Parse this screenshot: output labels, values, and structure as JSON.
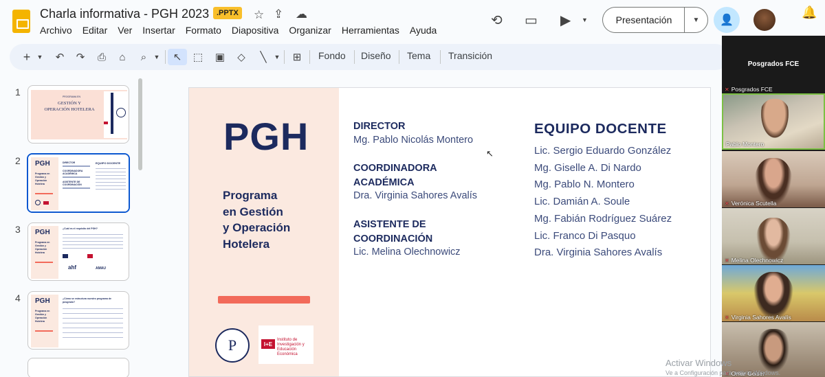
{
  "header": {
    "title": "Charla informativa - PGH 2023",
    "badge": ".PPTX",
    "menu": [
      "Archivo",
      "Editar",
      "Ver",
      "Insertar",
      "Formato",
      "Diapositiva",
      "Organizar",
      "Herramientas",
      "Ayuda"
    ],
    "present_label": "Presentación"
  },
  "toolbar": {
    "fondo": "Fondo",
    "diseno": "Diseño",
    "tema": "Tema",
    "transicion": "Transición"
  },
  "filmstrip": {
    "numbers": [
      "1",
      "2",
      "3",
      "4"
    ],
    "slide1": {
      "small": "PROGRAMA EN",
      "title1": "GESTIÓN Y",
      "title2": "OPERACIÓN HOTELERA"
    },
    "slide_pgh": "PGH",
    "slide2": {
      "left": "Programa en Gestión y Operación Hotelera",
      "col1a": "DIRECTOR",
      "col1b": "COORDINADORA ACADÉMICA",
      "col1c": "ASISTENTE DE COORDINACIÓN",
      "col2": "EQUIPO DOCENTE"
    },
    "slide3": {
      "q": "¿Cuál es el requisito del PGH?",
      "logo1": "ahf",
      "logo2": "AMAU"
    },
    "slide4": {
      "q": "¿Cómo se estructura nuestro programa de posgrado?"
    }
  },
  "slide": {
    "pgh": "PGH",
    "program": [
      "Programa",
      "en Gestión",
      "y Operación",
      "Hotelera"
    ],
    "director_role": "DIRECTOR",
    "director_name": "Mg. Pablo Nicolás Montero",
    "coord_role_1": "COORDINADORA",
    "coord_role_2": "ACADÉMICA",
    "coord_name": "Dra. Virginia Sahores Avalís",
    "asist_role_1": "ASISTENTE DE",
    "asist_role_2": "COORDINACIÓN",
    "asist_name": "Lic. Melina Olechnowicz",
    "equipo_title": "EQUIPO DOCENTE",
    "equipo": [
      "Lic. Sergio Eduardo González",
      "Mg. Giselle A. Di Nardo",
      "Mg. Pablo N. Montero",
      "Lic. Damián A. Soule",
      "Mg. Fabián Rodríguez Suárez",
      "Lic. Franco Di Pasquo",
      "Dra. Virginia Sahores Avalís"
    ],
    "seal_letter": "P",
    "iie_box": "I+E",
    "iie_text": "Instituto de Investigación y Educación Económica"
  },
  "video": {
    "host": "Posgrados FCE",
    "participants": [
      "Posgrados FCE",
      "Pablo Montero",
      "Verónica Scutella",
      "Melina Olechnowicz",
      "Virginia Sahores Avalís",
      "Omar Geiser"
    ]
  },
  "watermark": {
    "line1": "Activar Windows",
    "line2": "Ve a Configuración para activar Windows."
  }
}
